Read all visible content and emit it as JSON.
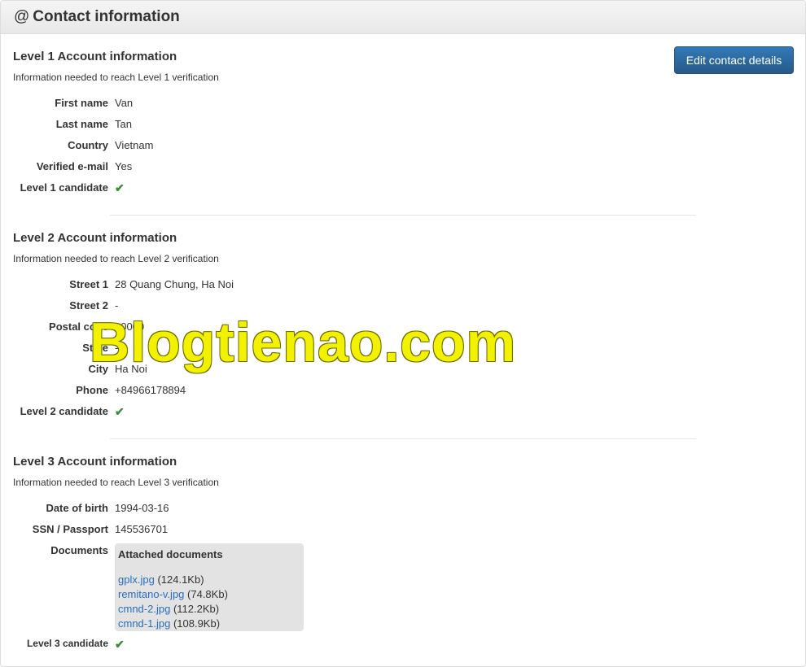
{
  "header": {
    "icon": "@",
    "title": "Contact information"
  },
  "edit_button_label": "Edit contact details",
  "level1": {
    "title": "Level 1 Account information",
    "subtitle": "Information needed to reach Level 1 verification",
    "fields": [
      {
        "label": "First name",
        "value": "Van"
      },
      {
        "label": "Last name",
        "value": "Tan"
      },
      {
        "label": "Country",
        "value": "Vietnam"
      },
      {
        "label": "Verified e-mail",
        "value": "Yes"
      }
    ],
    "candidate_label": "Level 1 candidate",
    "candidate_icon": "check-icon"
  },
  "level2": {
    "title": "Level 2 Account information",
    "subtitle": "Information needed to reach Level 2 verification",
    "fields": [
      {
        "label": "Street 1",
        "value": "28 Quang Chung, Ha Noi"
      },
      {
        "label": "Street 2",
        "value": "-"
      },
      {
        "label": "Postal code",
        "value": "10000"
      },
      {
        "label": "State",
        "value": "-"
      },
      {
        "label": "City",
        "value": "Ha Noi"
      },
      {
        "label": "Phone",
        "value": "+84966178894"
      }
    ],
    "candidate_label": "Level 2 candidate"
  },
  "level3": {
    "title": "Level 3 Account information",
    "subtitle": "Information needed to reach Level 3 verification",
    "fields": [
      {
        "label": "Date of birth",
        "value": "1994-03-16"
      },
      {
        "label": "SSN / Passport",
        "value": "145536701"
      }
    ],
    "documents_label": "Documents",
    "documents_box_title": "Attached documents",
    "documents": [
      {
        "name": "gplx.jpg",
        "size": "(124.1Kb)"
      },
      {
        "name": "remitano-v.jpg",
        "size": "(74.8Kb)"
      },
      {
        "name": "cmnd-2.jpg",
        "size": "(112.2Kb)"
      },
      {
        "name": "cmnd-1.jpg",
        "size": "(108.9Kb)"
      }
    ],
    "candidate_label": "Level 3 candidate"
  },
  "checkmark": "✔",
  "watermark": "Blogtienao.com",
  "colors": {
    "primary": "#337ab7",
    "check": "#3c8a3c",
    "watermark": "#f2f200"
  }
}
